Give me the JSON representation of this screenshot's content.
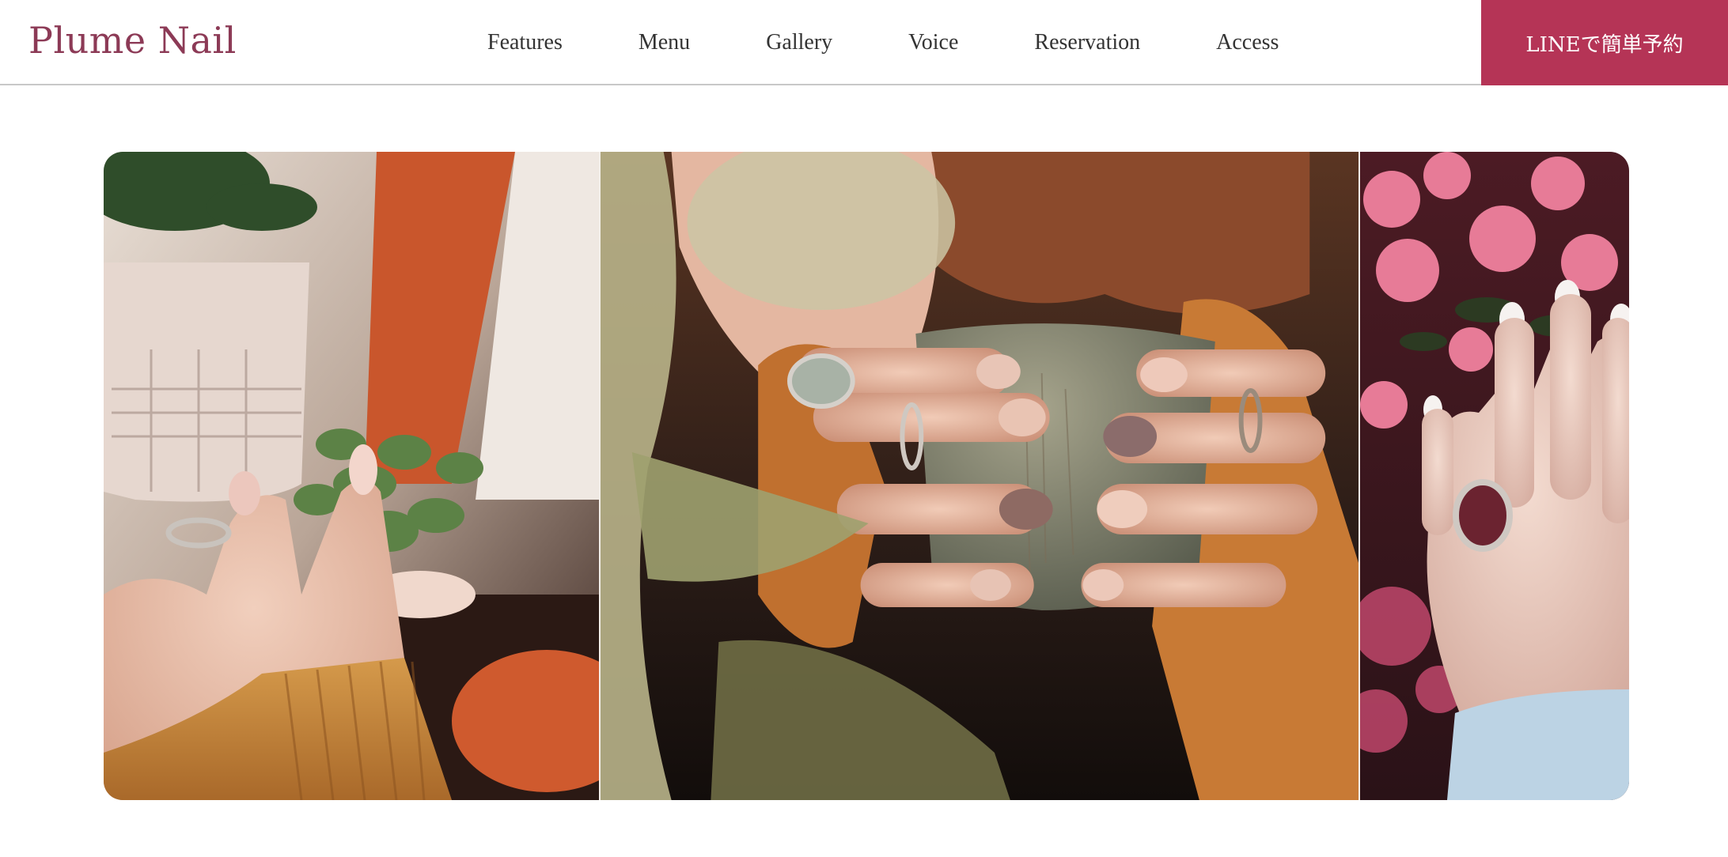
{
  "brand": {
    "logo_text": "Plume Nail",
    "accent_color": "#b53456",
    "logo_color": "#8c3a56"
  },
  "nav": {
    "items": [
      {
        "label": "Features"
      },
      {
        "label": "Menu"
      },
      {
        "label": "Gallery"
      },
      {
        "label": "Voice"
      },
      {
        "label": "Reservation"
      },
      {
        "label": "Access"
      }
    ]
  },
  "cta": {
    "label": "LINEで簡単予約"
  },
  "hero": {
    "photos": [
      {
        "subject": "hand-with-pink-nails-and-plants"
      },
      {
        "subject": "hands-holding-ceramic-cup"
      },
      {
        "subject": "hand-with-ring-and-pink-flowers"
      }
    ]
  }
}
